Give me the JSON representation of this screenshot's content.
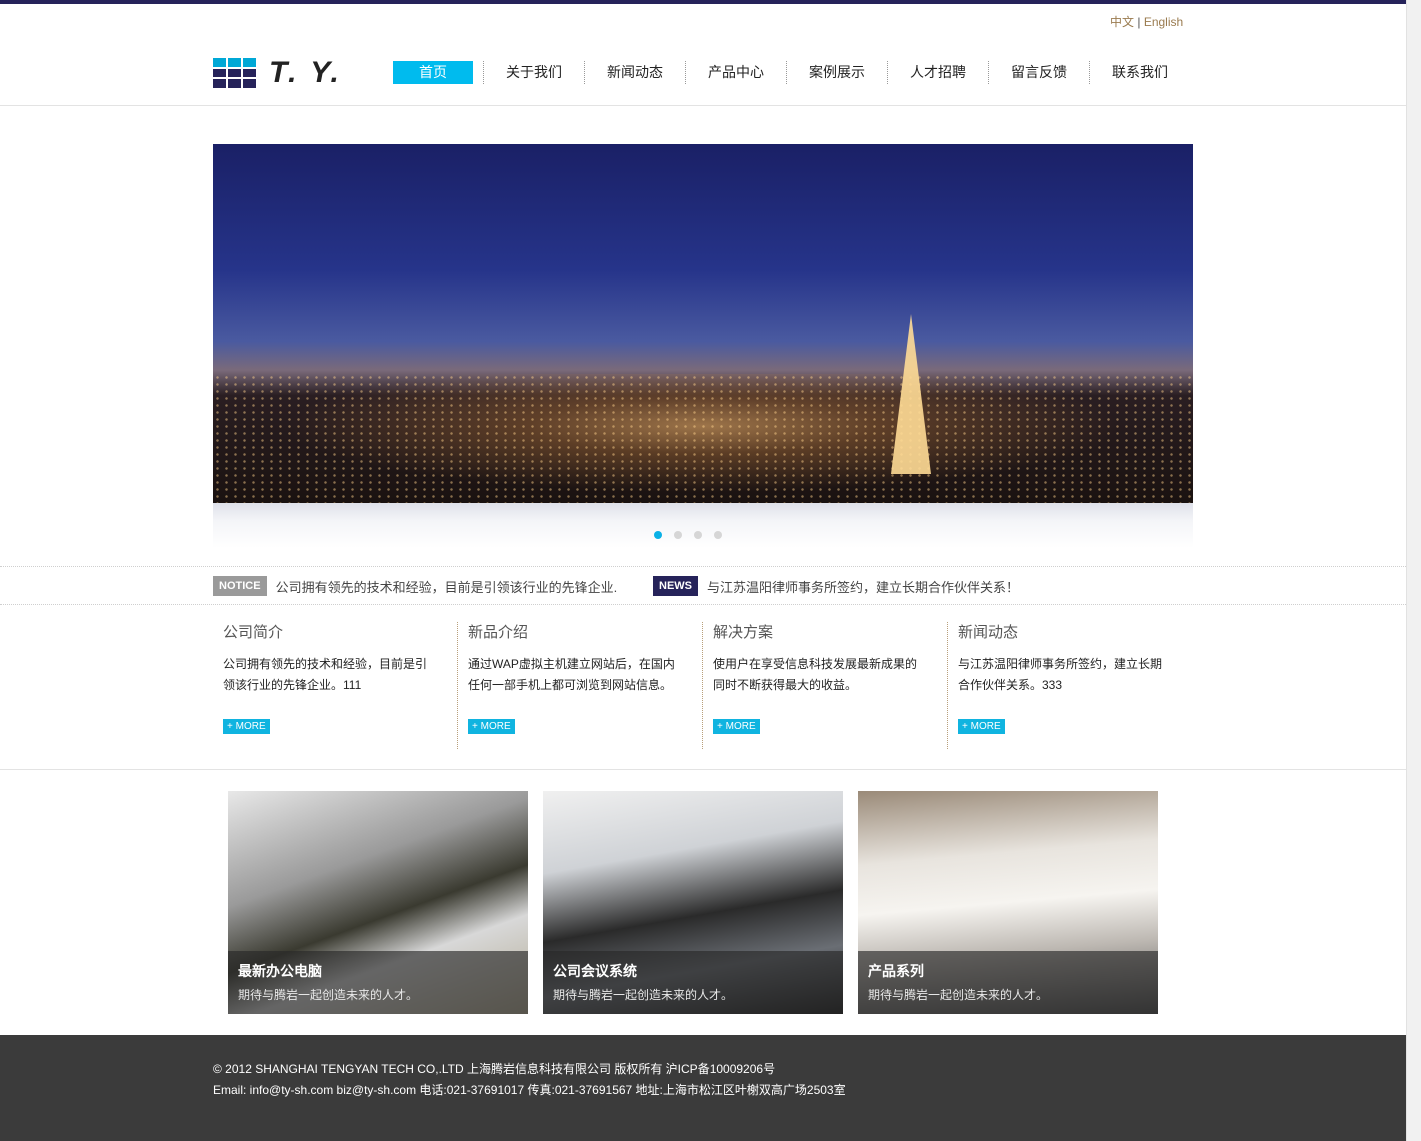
{
  "header": {
    "lang_zh": "中文",
    "lang_sep": "|",
    "lang_en": "English",
    "logo_text": "T. Y.",
    "nav": [
      "首页",
      "关于我们",
      "新闻动态",
      "产品中心",
      "案例展示",
      "人才招聘",
      "留言反馈",
      "联系我们"
    ],
    "active_index": 0
  },
  "banner": {
    "slides": 4,
    "current_slide": 1
  },
  "ticker": {
    "notice_tag": "NOTICE",
    "notice_text": "公司拥有领先的技术和经验，目前是引领该行业的先锋企业.",
    "news_tag": "NEWS",
    "news_text": "与江苏温阳律师事务所签约，建立长期合作伙伴关系！"
  },
  "columns": [
    {
      "title": "公司简介",
      "text": "公司拥有领先的技术和经验，目前是引领该行业的先锋企业。111",
      "more": "+ MORE"
    },
    {
      "title": "新品介绍",
      "text": "通过WAP虚拟主机建立网站后，在国内任何一部手机上都可浏览到网站信息。",
      "more": "+ MORE"
    },
    {
      "title": "解决方案",
      "text": "使用户在享受信息科技发展最新成果的同时不断获得最大的收益。",
      "more": "+ MORE"
    },
    {
      "title": "新闻动态",
      "text": "与江苏温阳律师事务所签约，建立长期合作伙伴关系。333",
      "more": "+ MORE"
    }
  ],
  "cards": [
    {
      "title": "最新办公电脑",
      "desc": "期待与腾岩一起创造未来的人才。"
    },
    {
      "title": "公司会议系统",
      "desc": "期待与腾岩一起创造未来的人才。"
    },
    {
      "title": "产品系列",
      "desc": "期待与腾岩一起创造未来的人才。"
    }
  ],
  "footer": {
    "line1": "© 2012 SHANGHAI TENGYAN TECH CO,.LTD 上海腾岩信息科技有限公司 版权所有 沪ICP备10009206号",
    "line2": "Email: info@ty-sh.com biz@ty-sh.com 电话:021-37691017 传真:021-37691567 地址:上海市松江区叶榭双高广场2503室"
  },
  "colors": {
    "brand_navy": "#26235a",
    "accent_cyan": "#00bbee",
    "footer_bg": "#3b3b3b"
  }
}
